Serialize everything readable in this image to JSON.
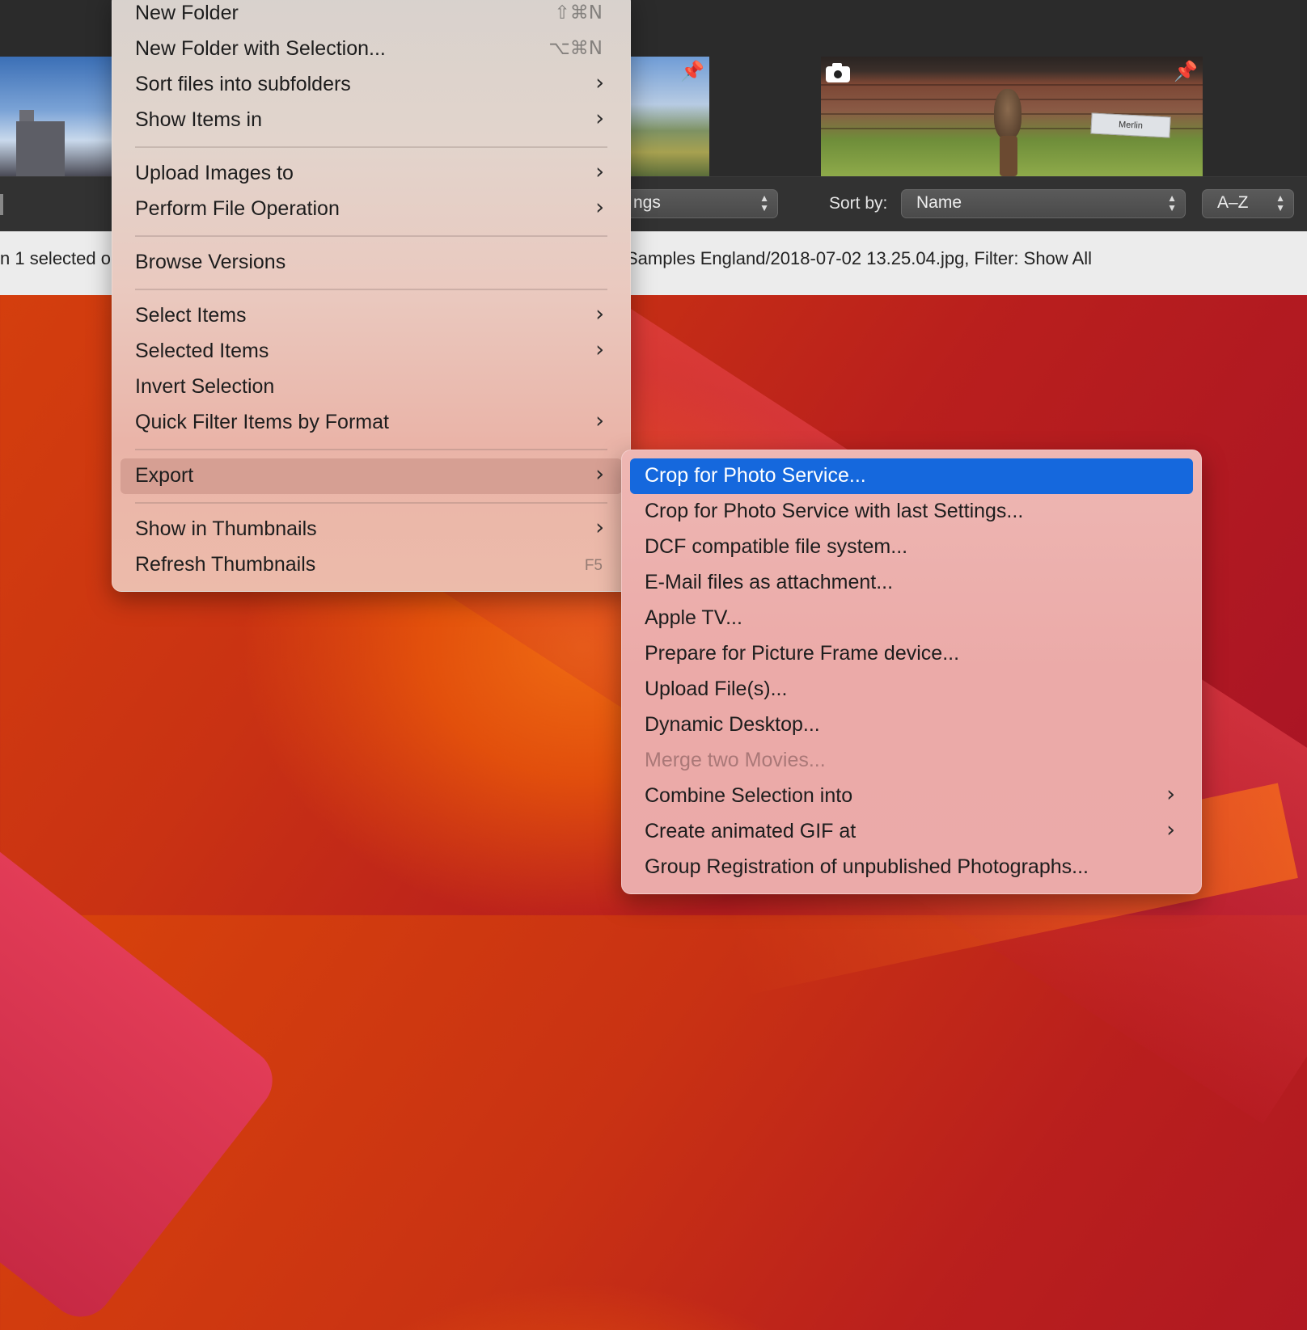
{
  "window": {
    "status_left": "n 1 selected o",
    "status_right": "Samples England/2018-07-02 13.25.04.jpg, Filter: Show All",
    "view_popup_label": "ngs",
    "sort_by_label": "Sort by:",
    "sort_by_value": "Name",
    "sort_order_value": "A–Z",
    "merlin_sign": "Merlin",
    "pin_icon_glyph": "📌"
  },
  "main_menu": {
    "items": [
      {
        "label": "New Folder",
        "shortcut": "⇧⌘N"
      },
      {
        "label": "New Folder with Selection...",
        "shortcut": "⌥⌘N"
      },
      {
        "label": "Sort files into subfolders",
        "submenu": true
      },
      {
        "label": "Show Items in",
        "submenu": true
      },
      {
        "label": "Upload Images to",
        "submenu": true
      },
      {
        "label": "Perform File Operation",
        "submenu": true
      },
      {
        "label": "Browse Versions"
      },
      {
        "label": "Select Items",
        "submenu": true
      },
      {
        "label": "Selected Items",
        "submenu": true
      },
      {
        "label": "Invert Selection"
      },
      {
        "label": "Quick Filter Items by Format",
        "submenu": true
      },
      {
        "label": "Export",
        "submenu": true,
        "highlighted": true
      },
      {
        "label": "Show in Thumbnails",
        "submenu": true
      },
      {
        "label": "Refresh Thumbnails",
        "shortcut": "F5"
      }
    ],
    "chevron": "›"
  },
  "export_submenu": {
    "items": [
      {
        "label": "Crop for Photo Service...",
        "selected": true
      },
      {
        "label": "Crop for Photo Service with last Settings..."
      },
      {
        "label": "DCF compatible file system..."
      },
      {
        "label": "E-Mail files as attachment..."
      },
      {
        "label": "Apple TV..."
      },
      {
        "label": "Prepare for Picture Frame device..."
      },
      {
        "label": "Upload File(s)..."
      },
      {
        "label": "Dynamic Desktop..."
      },
      {
        "label": "Merge two Movies...",
        "disabled": true
      },
      {
        "label": "Combine Selection into",
        "submenu": true
      },
      {
        "label": "Create animated GIF at",
        "submenu": true
      },
      {
        "label": "Group Registration of unpublished Photographs..."
      }
    ],
    "selection_color": "#1568dd"
  }
}
